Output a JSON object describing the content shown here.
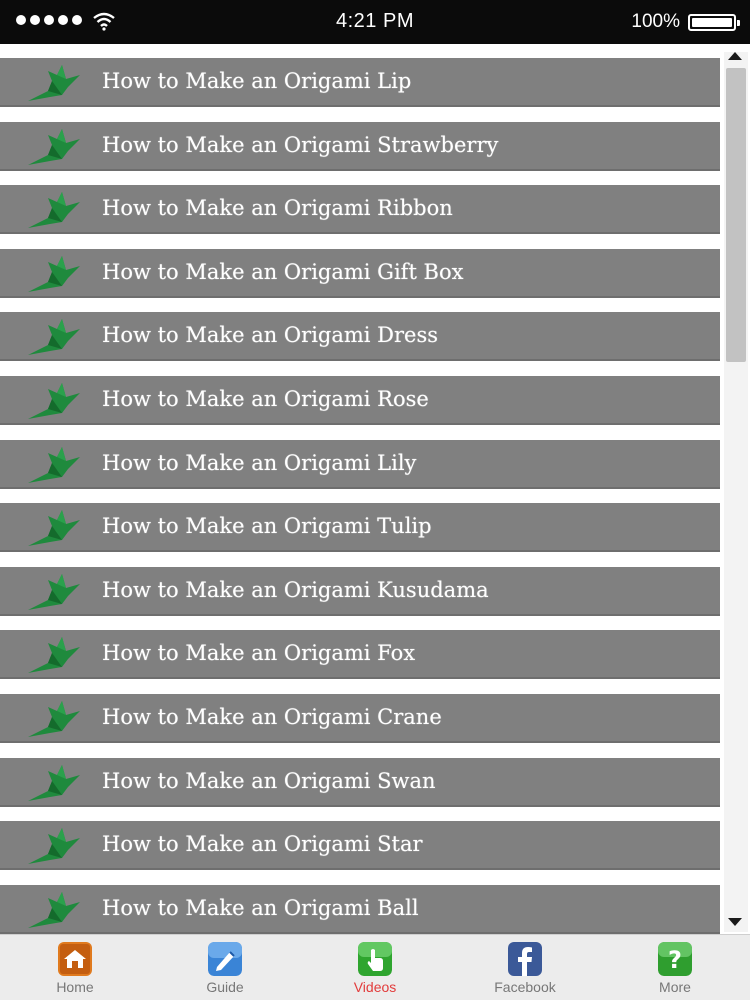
{
  "status_bar": {
    "time": "4:21 PM",
    "battery": "100%"
  },
  "list": {
    "icon": "origami-crane-icon",
    "icon_color": "#1f8a3d",
    "items": [
      {
        "label": "How to Make an Origami Lip"
      },
      {
        "label": "How to Make an Origami Strawberry"
      },
      {
        "label": "How to Make an Origami Ribbon"
      },
      {
        "label": "How to Make an Origami Gift Box"
      },
      {
        "label": "How to Make an Origami Dress"
      },
      {
        "label": "How to Make an Origami Rose"
      },
      {
        "label": "How to Make an Origami Lily"
      },
      {
        "label": "How to Make an Origami Tulip"
      },
      {
        "label": "How to Make an Origami Kusudama"
      },
      {
        "label": "How to Make an Origami Fox"
      },
      {
        "label": "How to Make an Origami Crane"
      },
      {
        "label": "How to Make an Origami Swan"
      },
      {
        "label": "How to Make an Origami Star"
      },
      {
        "label": "How to Make an Origami Ball"
      }
    ]
  },
  "tab_bar": {
    "active_color": "#e23b3b",
    "tabs": [
      {
        "label": "Home",
        "icon": "home-icon"
      },
      {
        "label": "Guide",
        "icon": "guide-icon"
      },
      {
        "label": "Videos",
        "icon": "videos-icon",
        "active": true
      },
      {
        "label": "Facebook",
        "icon": "facebook-icon"
      },
      {
        "label": "More",
        "icon": "more-icon"
      }
    ]
  }
}
